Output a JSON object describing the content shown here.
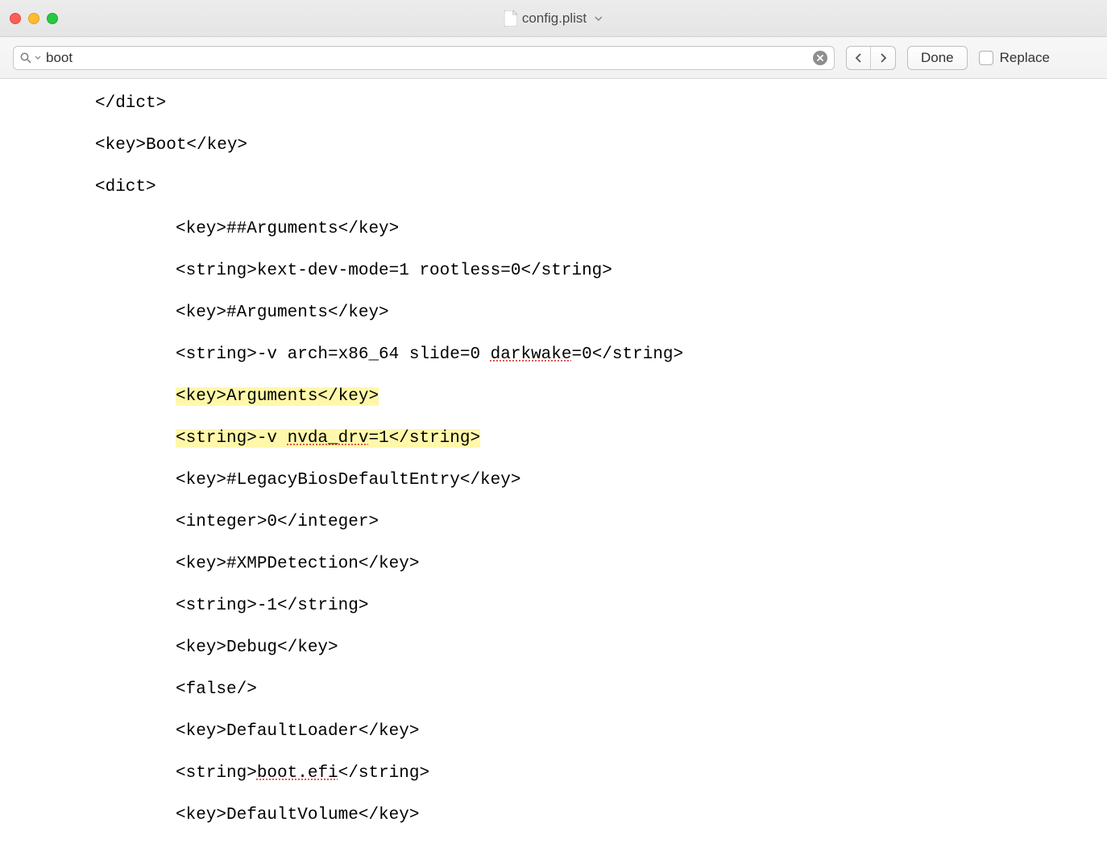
{
  "titlebar": {
    "file_icon": "doc-icon",
    "filename": "config.plist",
    "dropdown_icon": "chevron-down"
  },
  "findbar": {
    "search_value": "boot",
    "search_placeholder": "",
    "clear_icon": "×",
    "prev_icon": "<",
    "next_icon": ">",
    "done_label": "Done",
    "replace_label": "Replace",
    "replace_checked": false
  },
  "code": {
    "lines": [
      {
        "text": "</dict>",
        "indent": 1
      },
      {
        "text": "<key>Boot</key>",
        "indent": 1
      },
      {
        "text": "<dict>",
        "indent": 1
      },
      {
        "text": "<key>##Arguments</key>",
        "indent": 2
      },
      {
        "text": "<string>kext-dev-mode=1 rootless=0</string>",
        "indent": 2
      },
      {
        "text": "<key>#Arguments</key>",
        "indent": 2
      },
      {
        "segments": [
          {
            "t": "<string>-v arch=x86_64 slide=0 "
          },
          {
            "t": "darkwake",
            "spellwave": true
          },
          {
            "t": "=0</string>"
          }
        ],
        "indent": 2
      },
      {
        "text": "<key>Arguments</key>",
        "indent": 2,
        "highlight": true
      },
      {
        "segments": [
          {
            "t": "<string>-v "
          },
          {
            "t": "nvda_drv",
            "spellwave": true
          },
          {
            "t": "=1</string>"
          }
        ],
        "indent": 2,
        "highlight": true
      },
      {
        "text": "<key>#LegacyBiosDefaultEntry</key>",
        "indent": 2
      },
      {
        "text": "<integer>0</integer>",
        "indent": 2
      },
      {
        "text": "<key>#XMPDetection</key>",
        "indent": 2
      },
      {
        "text": "<string>-1</string>",
        "indent": 2
      },
      {
        "text": "<key>Debug</key>",
        "indent": 2
      },
      {
        "text": "<false/>",
        "indent": 2
      },
      {
        "text": "<key>DefaultLoader</key>",
        "indent": 2
      },
      {
        "segments": [
          {
            "t": "<string>"
          },
          {
            "t": "boot.efi",
            "spellwave": true
          },
          {
            "t": "</string>"
          }
        ],
        "indent": 2
      },
      {
        "text": "<key>DefaultVolume</key>",
        "indent": 2
      }
    ]
  }
}
